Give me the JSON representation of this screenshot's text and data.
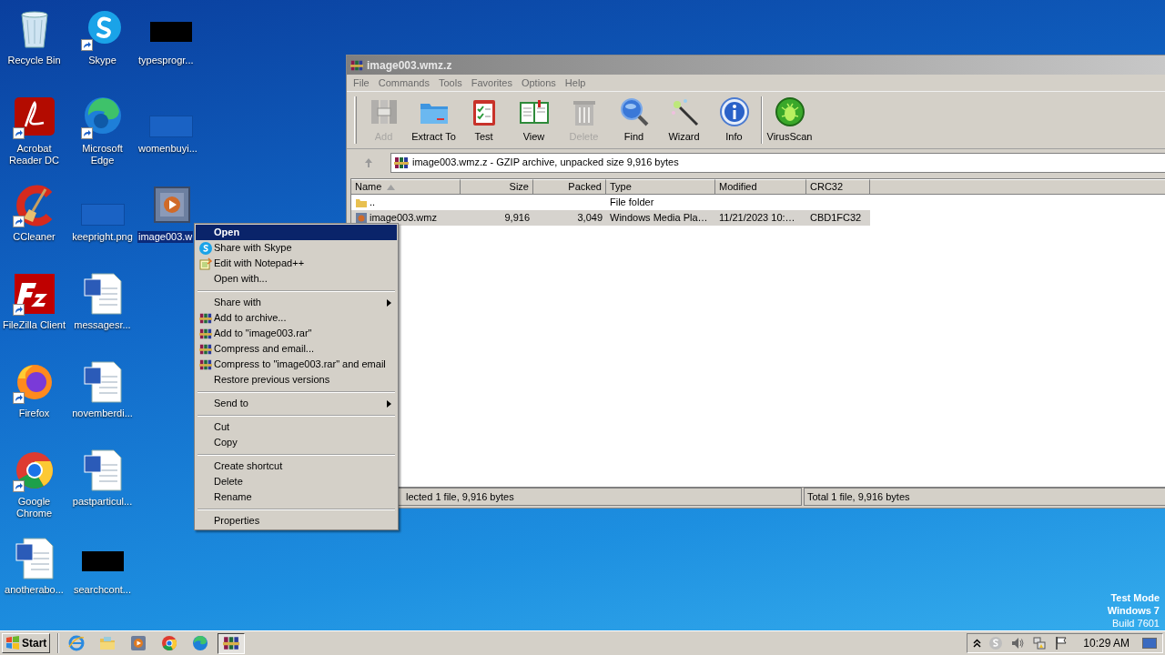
{
  "desktop": {
    "columns": [
      [
        {
          "label": "Recycle Bin",
          "kind": "recycle",
          "shortcut": false,
          "selected": false
        },
        {
          "label": "Acrobat Reader DC",
          "kind": "acrobat",
          "shortcut": true,
          "selected": false
        },
        {
          "label": "CCleaner",
          "kind": "ccleaner",
          "shortcut": true,
          "selected": false
        },
        {
          "label": "FileZilla Client",
          "kind": "filezilla",
          "shortcut": true,
          "selected": false
        },
        {
          "label": "Firefox",
          "kind": "firefox",
          "shortcut": true,
          "selected": false
        },
        {
          "label": "Google Chrome",
          "kind": "chrome",
          "shortcut": true,
          "selected": false
        },
        {
          "label": "anotherabo...",
          "kind": "word",
          "shortcut": false,
          "selected": false
        }
      ],
      [
        {
          "label": "Skype",
          "kind": "skype",
          "shortcut": true,
          "selected": false
        },
        {
          "label": "Microsoft Edge",
          "kind": "edge",
          "shortcut": true,
          "selected": false
        },
        {
          "label": "keepright.png",
          "kind": "thumbnail",
          "shortcut": false,
          "selected": false
        },
        {
          "label": "messagesr...",
          "kind": "word",
          "shortcut": false,
          "selected": false
        },
        {
          "label": "novemberdi...",
          "kind": "word",
          "shortcut": false,
          "selected": false
        },
        {
          "label": "pastparticul...",
          "kind": "word",
          "shortcut": false,
          "selected": false
        },
        {
          "label": "searchcont...",
          "kind": "redacted",
          "shortcut": false,
          "selected": false
        }
      ],
      [
        {
          "label": "typesprogr...",
          "kind": "redacted",
          "shortcut": false,
          "selected": false
        },
        {
          "label": "womenbuyi...",
          "kind": "thumbnail",
          "shortcut": false,
          "selected": false
        },
        {
          "label": "image003.w",
          "kind": "video",
          "shortcut": false,
          "selected": true
        }
      ]
    ]
  },
  "window": {
    "title": "image003.wmz.z",
    "menu": [
      "File",
      "Commands",
      "Tools",
      "Favorites",
      "Options",
      "Help"
    ],
    "toolbar": [
      {
        "label": "Add",
        "kind": "add",
        "disabled": true
      },
      {
        "label": "Extract To",
        "kind": "extract",
        "disabled": false
      },
      {
        "label": "Test",
        "kind": "test",
        "disabled": false
      },
      {
        "label": "View",
        "kind": "view",
        "disabled": false
      },
      {
        "label": "Delete",
        "kind": "delete",
        "disabled": true
      },
      {
        "label": "Find",
        "kind": "find",
        "disabled": false
      },
      {
        "label": "Wizard",
        "kind": "wizard",
        "disabled": false
      },
      {
        "label": "Info",
        "kind": "info",
        "disabled": false
      },
      {
        "label": "VirusScan",
        "kind": "virus",
        "disabled": false
      }
    ],
    "address": "image003.wmz.z - GZIP archive, unpacked size 9,916 bytes",
    "columns": [
      "Name",
      "Size",
      "Packed",
      "Type",
      "Modified",
      "CRC32"
    ],
    "rows": [
      {
        "kind": "folder",
        "name": "..",
        "type": "File folder",
        "selected": false
      },
      {
        "kind": "file",
        "name": "image003.wmz",
        "size": "9,916",
        "packed": "3,049",
        "type": "Windows Media Pla…",
        "modified": "11/21/2023 10:…",
        "crc32": "CBD1FC32",
        "selected": true
      }
    ],
    "status_bar": [
      "lected 1 file, 9,916 bytes",
      "Total 1 file, 9,916 bytes"
    ]
  },
  "context_menu": {
    "groups": [
      [
        {
          "label": "Open",
          "default": true,
          "submenu": false,
          "selected": true
        },
        {
          "label": "Share with Skype",
          "kind": "skype",
          "default": false,
          "submenu": false,
          "selected": false
        },
        {
          "label": "Edit with Notepad++",
          "kind": "notepad",
          "default": false,
          "submenu": false,
          "selected": false
        },
        {
          "label": "Open with...",
          "default": false,
          "submenu": false,
          "selected": false
        }
      ],
      [
        {
          "label": "Share with",
          "default": false,
          "submenu": true,
          "selected": false
        },
        {
          "label": "Add to archive...",
          "kind": "winrar",
          "default": false,
          "submenu": false,
          "selected": false
        },
        {
          "label": "Add to \"image003.rar\"",
          "kind": "winrar",
          "default": false,
          "submenu": false,
          "selected": false
        },
        {
          "label": "Compress and email...",
          "kind": "winrar",
          "default": false,
          "submenu": false,
          "selected": false
        },
        {
          "label": "Compress to \"image003.rar\" and email",
          "kind": "winrar",
          "default": false,
          "submenu": false,
          "selected": false
        },
        {
          "label": "Restore previous versions",
          "default": false,
          "submenu": false,
          "selected": false
        }
      ],
      [
        {
          "label": "Send to",
          "default": false,
          "submenu": true,
          "selected": false
        }
      ],
      [
        {
          "label": "Cut",
          "default": false,
          "submenu": false,
          "selected": false
        },
        {
          "label": "Copy",
          "default": false,
          "submenu": false,
          "selected": false
        }
      ],
      [
        {
          "label": "Create shortcut",
          "default": false,
          "submenu": false,
          "selected": false
        },
        {
          "label": "Delete",
          "default": false,
          "submenu": false,
          "selected": false
        },
        {
          "label": "Rename",
          "default": false,
          "submenu": false,
          "selected": false
        }
      ],
      [
        {
          "label": "Properties",
          "default": false,
          "submenu": false,
          "selected": false
        }
      ]
    ]
  },
  "system_notice": [
    "Test Mode",
    "Windows 7",
    "Build 7601"
  ],
  "taskbar": {
    "start": "Start",
    "apps": [
      {
        "kind": "ie",
        "active": false
      },
      {
        "kind": "explorer",
        "active": false
      },
      {
        "kind": "media",
        "active": false
      },
      {
        "kind": "chrome",
        "active": false
      },
      {
        "kind": "edge",
        "active": false
      },
      {
        "kind": "winrar",
        "active": true
      }
    ],
    "clock": "10:29 AM"
  }
}
